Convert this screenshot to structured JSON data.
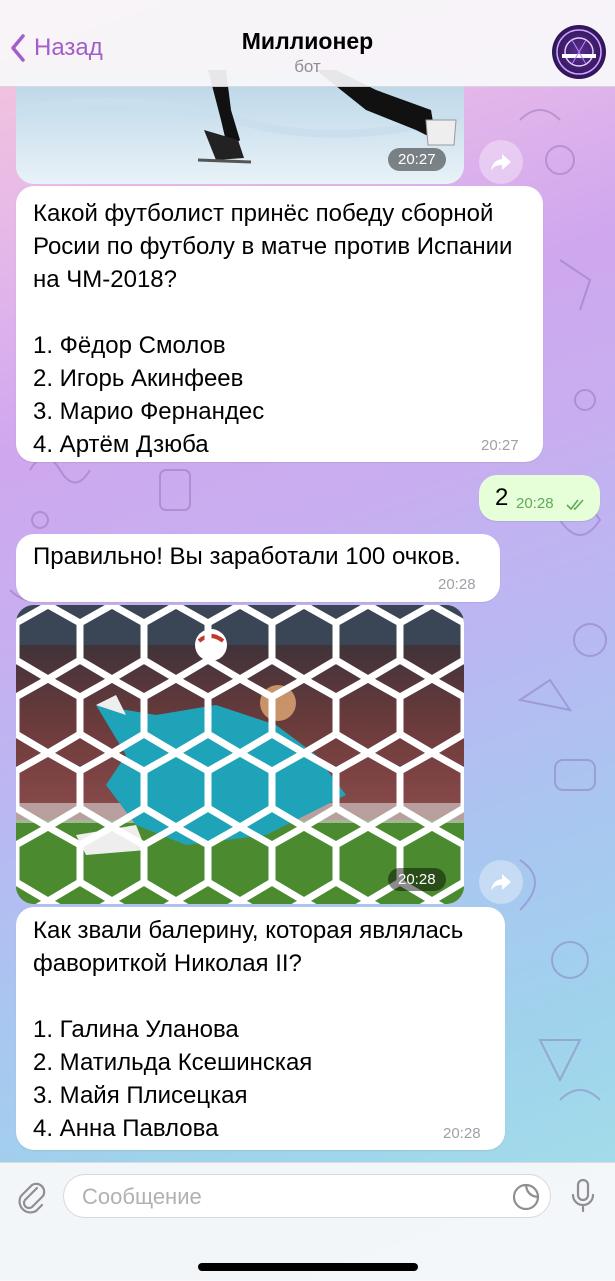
{
  "header": {
    "back_label": "Назад",
    "title": "Миллионер",
    "subtitle": "бот"
  },
  "messages": {
    "photo1_time": "20:27",
    "q1_text": "Какой футболист принёс победу сборной Росии по футболу в матче против Испании на ЧМ-2018?\n\n1. Фёдор Смолов\n2. Игорь Акинфеев\n3. Марио Фернандес\n4. Артём Дзюба",
    "q1_time": "20:27",
    "answer_text": "2",
    "answer_time": "20:28",
    "reply_text": "Правильно! Вы заработали 100 очков.",
    "reply_time": "20:28",
    "photo2_time": "20:28",
    "q2_text": "Как звали балерину, которая являлась фавориткой Николая II?\n\n1. Галина Уланова\n2. Матильда Ксешинская\n3. Майя Плисецкая\n4. Анна Павлова",
    "q2_time": "20:28"
  },
  "input": {
    "placeholder": "Сообщение"
  },
  "colors": {
    "accent": "#a25ec9",
    "outgoing_bubble": "#e6ffd8",
    "incoming_bubble": "#ffffff"
  },
  "icons": [
    "chevron-left-icon",
    "share-icon",
    "attach-icon",
    "sticker-icon",
    "microphone-icon",
    "double-check-icon"
  ]
}
